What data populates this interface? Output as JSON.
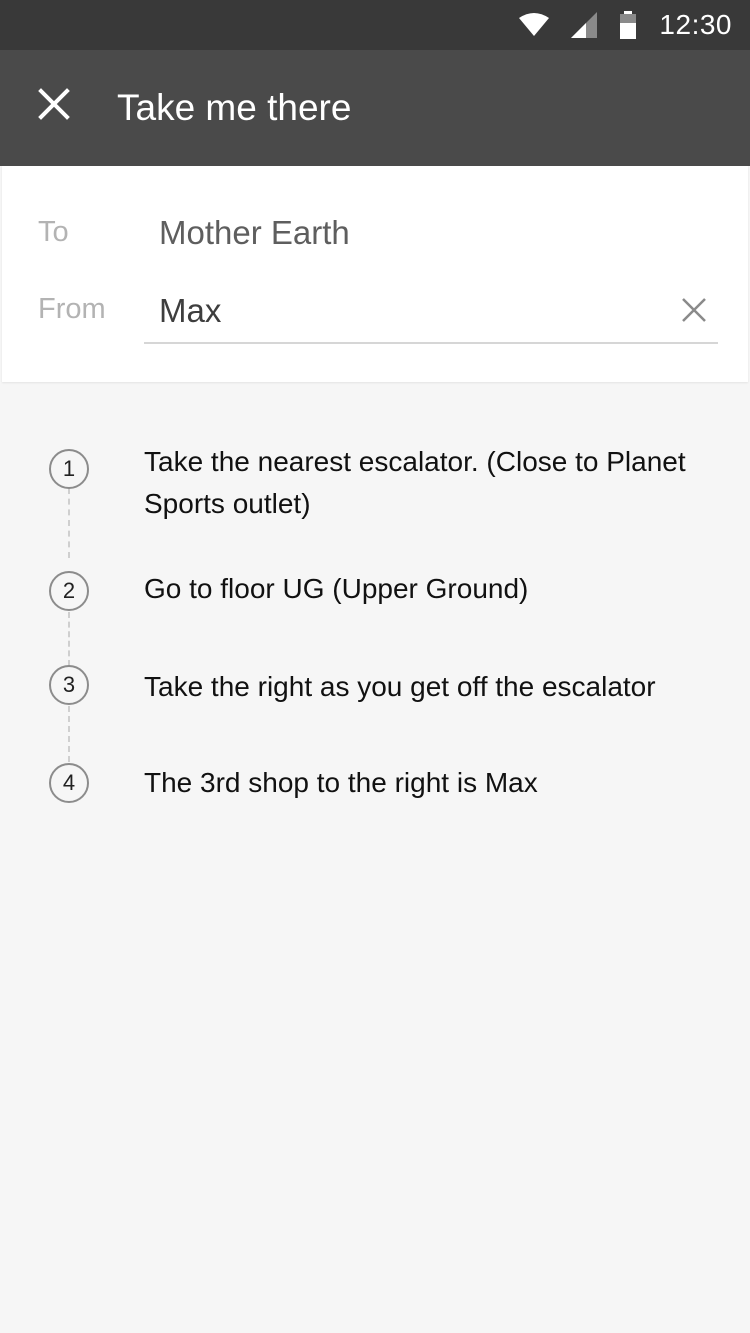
{
  "status_bar": {
    "time": "12:30",
    "icons": [
      "wifi-icon",
      "cell-signal-icon",
      "battery-icon"
    ]
  },
  "app_bar": {
    "title": "Take me there",
    "close_icon": "close-icon"
  },
  "route": {
    "to_label": "To",
    "to_value": "Mother Earth",
    "from_label": "From",
    "from_value": "Max",
    "clear_icon": "clear-icon"
  },
  "steps": [
    {
      "number": "1",
      "text": "Take the nearest escalator. (Close to Planet Sports outlet)"
    },
    {
      "number": "2",
      "text": "Go to floor UG (Upper Ground)"
    },
    {
      "number": "3",
      "text": "Take the right as you get off the escalator"
    },
    {
      "number": "4",
      "text": "The 3rd shop to the right is Max"
    }
  ],
  "colors": {
    "status_bar": "#393939",
    "app_bar": "#4a4a4a",
    "background": "#f6f6f6"
  }
}
